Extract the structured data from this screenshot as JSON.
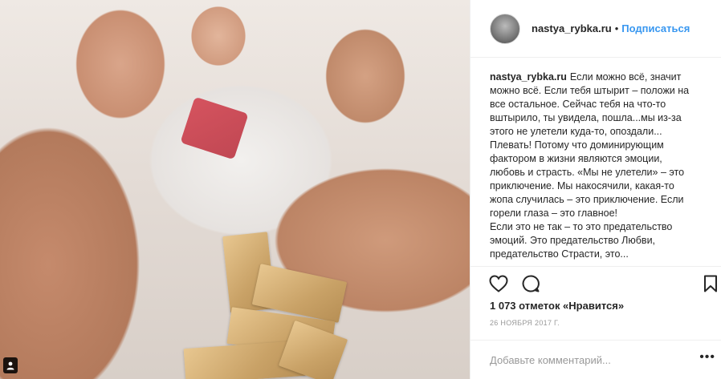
{
  "photo": {
    "description_icon": "user-tag-icon"
  },
  "header": {
    "username": "nastya_rybka.ru",
    "separator": "•",
    "follow_label": "Подписаться"
  },
  "caption": {
    "username": "nastya_rybka.ru",
    "text": "Если можно всё, значит можно всё. Если тебя штырит – положи на все остальное. Сейчас тебя на что-то вштырило, ты увидела, пошла...мы из-за этого не улетели куда-то, опоздали... Плевать! Потому что доминирующим фактором в жизни являются эмоции, любовь и страсть. «Мы не улетели» – это приключение. Мы накосячили, какая-то жопа случилась – это приключение. Если горели глаза – это главное!\nЕсли это не так – то это предательство эмоций. Это предательство Любви, предательство Страсти, это..."
  },
  "actions": {
    "like_icon": "heart-icon",
    "comment_icon": "comment-bubble-icon",
    "save_icon": "bookmark-icon"
  },
  "likes": "1 073 отметок «Нравится»",
  "date": "26 НОЯБРЯ 2017 Г.",
  "comment": {
    "placeholder": "Добавьте комментарий...",
    "more_label": "•••"
  },
  "colors": {
    "link": "#3897f0",
    "text": "#262626",
    "muted": "#999999",
    "border": "#efefef"
  }
}
